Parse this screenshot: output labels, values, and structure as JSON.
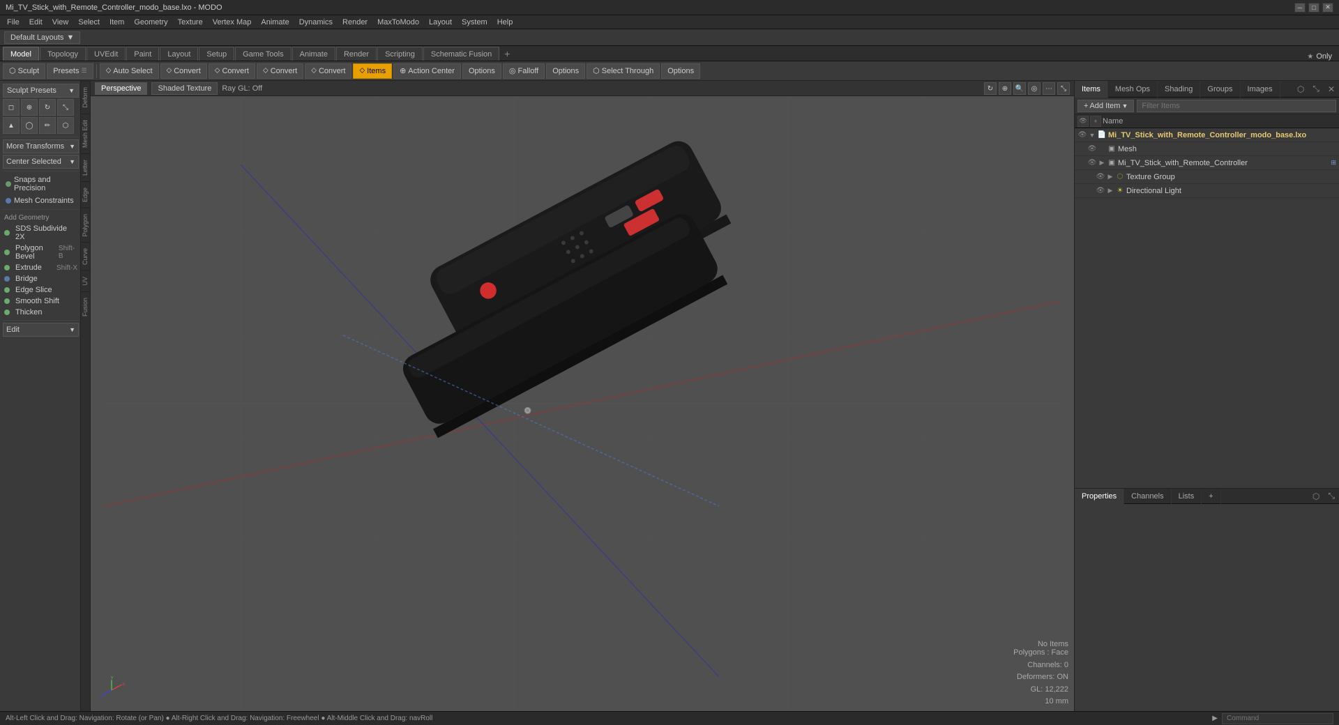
{
  "titlebar": {
    "title": "Mi_TV_Stick_with_Remote_Controller_modo_base.lxo - MODO",
    "min": "─",
    "max": "□",
    "close": "✕"
  },
  "menubar": {
    "items": [
      "File",
      "Edit",
      "View",
      "Select",
      "Item",
      "Geometry",
      "Texture",
      "Vertex Map",
      "Animate",
      "Dynamics",
      "Render",
      "MaxToModo",
      "Layout",
      "System",
      "Help"
    ]
  },
  "layout_bar": {
    "label": "Default Layouts",
    "arrow": "▼"
  },
  "tabs": [
    {
      "label": "Model",
      "active": true
    },
    {
      "label": "Topology"
    },
    {
      "label": "UVEdit"
    },
    {
      "label": "Paint"
    },
    {
      "label": "Layout"
    },
    {
      "label": "Setup"
    },
    {
      "label": "Game Tools"
    },
    {
      "label": "Animate"
    },
    {
      "label": "Render"
    },
    {
      "label": "Scripting"
    },
    {
      "label": "Schematic Fusion"
    },
    {
      "label": "+"
    }
  ],
  "toolbar": {
    "sculpt_label": "Sculpt",
    "presets_label": "Presets",
    "auto_select_label": "Auto Select",
    "convert1_label": "Convert",
    "convert2_label": "Convert",
    "convert3_label": "Convert",
    "convert4_label": "Convert",
    "items_label": "Items",
    "action_center_label": "Action Center",
    "options1_label": "Options",
    "falloff_label": "Falloff",
    "options2_label": "Options",
    "select_through_label": "Select Through",
    "options3_label": "Options",
    "only_label": "Only",
    "star_label": "★"
  },
  "left_panel": {
    "sculpt_presets_label": "Sculpt Presets",
    "icon_grid_count": 8,
    "more_transforms_label": "More Transforms",
    "center_selected_label": "Center Selected",
    "snaps_precision_label": "Snaps and Precision",
    "mesh_constraints_label": "Mesh Constraints",
    "add_geometry_label": "Add Geometry",
    "sds_subdivide_label": "SDS Subdivide 2X",
    "polygon_bevel_label": "Polygon Bevel",
    "polygon_bevel_shortcut": "Shift-B",
    "extrude_label": "Extrude",
    "extrude_shortcut": "Shift-X",
    "bridge_label": "Bridge",
    "edge_slice_label": "Edge Slice",
    "smooth_shift_label": "Smooth Shift",
    "thicken_label": "Thicken",
    "edit_label": "Edit",
    "side_tabs": [
      "Deform",
      "Mesh Edit",
      "Letter",
      "Edge",
      "Polygon",
      "Curve",
      "UV",
      "Fusion"
    ]
  },
  "viewport": {
    "tab_perspective": "Perspective",
    "tab_shaded": "Shaded Texture",
    "ray_gl_label": "Ray GL: Off",
    "no_items_label": "No Items",
    "polygons_label": "Polygons : Face",
    "channels_label": "Channels: 0",
    "deformers_label": "Deformers: ON",
    "gl_label": "GL: 12,222",
    "scale_label": "10 mm",
    "axis_x": "X",
    "axis_y": "Y",
    "axis_z": "Z"
  },
  "right_panel": {
    "tabs": [
      {
        "label": "Items",
        "active": true
      },
      {
        "label": "Mesh Ops"
      },
      {
        "label": "Shading"
      },
      {
        "label": "Groups"
      },
      {
        "label": "Images"
      }
    ],
    "add_item_label": "Add Item",
    "filter_placeholder": "Filter Items",
    "col_name": "Name",
    "items": [
      {
        "id": "root",
        "level": 0,
        "name": "Mi_TV_Stick_with_Remote_Controller_modo_base.lxo",
        "type": "lxo",
        "icon": "📄",
        "has_eye": true,
        "expand": "▼"
      },
      {
        "id": "mesh",
        "level": 1,
        "name": "Mesh",
        "type": "mesh",
        "icon": "▣",
        "has_eye": true,
        "expand": ""
      },
      {
        "id": "remote",
        "level": 1,
        "name": "Mi_TV_Stick_with_Remote_Controller",
        "type": "mesh",
        "icon": "▣",
        "has_eye": true,
        "expand": "▶",
        "link": "⊞"
      },
      {
        "id": "texture",
        "level": 2,
        "name": "Texture Group",
        "type": "texture",
        "icon": "⬡",
        "has_eye": true,
        "expand": "▶"
      },
      {
        "id": "light",
        "level": 2,
        "name": "Directional Light",
        "type": "light",
        "icon": "☀",
        "has_eye": true,
        "expand": "▶"
      }
    ],
    "bottom_tabs": [
      {
        "label": "Properties",
        "active": true
      },
      {
        "label": "Channels"
      },
      {
        "label": "Lists"
      },
      {
        "label": "+"
      }
    ]
  },
  "statusbar": {
    "hint": "Alt-Left Click and Drag: Navigation: Rotate (or Pan) ● Alt-Right Click and Drag: Navigation: Freewheel ● Alt-Middle Click and Drag: navRoll",
    "arrow": "▶",
    "command_placeholder": "Command"
  }
}
